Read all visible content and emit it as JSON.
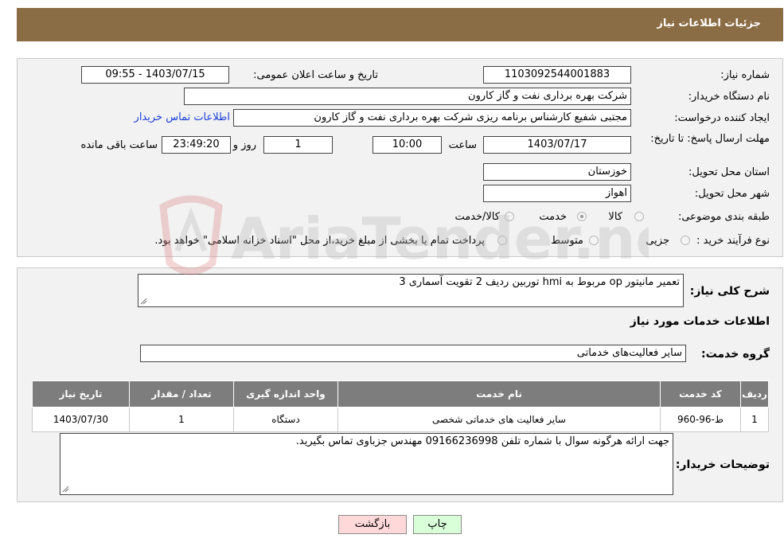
{
  "header": {
    "title": "جزئیات اطلاعات نیاز"
  },
  "form": {
    "need_number": {
      "label": "شماره نیاز:",
      "value": "1103092544001883"
    },
    "announce_datetime": {
      "label": "تاریخ و ساعت اعلان عمومی:",
      "value": "1403/07/15 - 09:55"
    },
    "buyer_org": {
      "label": "نام دستگاه خریدار:",
      "value": "شرکت بهره برداری نفت و گاز کارون"
    },
    "requester": {
      "label": "ایجاد کننده درخواست:",
      "value": "مجتبی شفیع کارشناس برنامه ریزی شرکت بهره برداری نفت و گاز کارون",
      "contact_link": "اطلاعات تماس خریدار"
    },
    "deadline": {
      "label": "مهلت ارسال پاسخ: تا تاریخ:",
      "date": "1403/07/17",
      "time_label": "ساعت",
      "time": "10:00",
      "days": "1",
      "days_label": "روز و",
      "remaining": "23:49:20",
      "remaining_label": "ساعت باقی مانده"
    },
    "province": {
      "label": "استان محل تحویل:",
      "value": "خوزستان"
    },
    "city": {
      "label": "شهر محل تحویل:",
      "value": "اهواز"
    },
    "category": {
      "label": "طبقه بندی موضوعی:",
      "options": [
        {
          "label": "کالا",
          "selected": false
        },
        {
          "label": "خدمت",
          "selected": true
        },
        {
          "label": "کالا/خدمت",
          "selected": false
        }
      ]
    },
    "purchase_type": {
      "label": "نوع فرآیند خرید :",
      "options": [
        {
          "label": "جزیی",
          "selected": false
        },
        {
          "label": "متوسط",
          "selected": false
        }
      ],
      "note": "پرداخت تمام یا بخشی از مبلغ خرید،از محل \"اسناد خزانه اسلامی\" خواهد بود."
    }
  },
  "details": {
    "summary_label": "شرح کلی نیاز:",
    "summary": "تعمیر مانیتور op مربوط به hmi توربین ردیف 2 تقویت آسماری 3",
    "services_heading": "اطلاعات خدمات مورد نیاز",
    "service_group_label": "گروه خدمت:",
    "service_group": "سایر فعالیت‌های خدماتی",
    "table": {
      "columns": [
        "ردیف",
        "کد خدمت",
        "نام خدمت",
        "واحد اندازه گیری",
        "تعداد / مقدار",
        "تاریخ نیاز"
      ],
      "rows": [
        [
          "1",
          "ط-96-960",
          "سایر فعالیت های خدماتی شخصی",
          "دستگاه",
          "1",
          "1403/07/30"
        ]
      ]
    },
    "buyer_notes_label": "توضیحات خریدار:",
    "buyer_notes": "جهت ارائه هرگونه سوال با شماره تلفن 09166236998 مهندس جزباوی تماس بگیرید."
  },
  "buttons": {
    "print": "چاپ",
    "back": "بازگشت"
  },
  "watermark": "AriaTender.neT",
  "colors": {
    "header": "#8b6d45",
    "link": "#1a3fd9",
    "back_button": "#ffd9d9",
    "print_button": "#d9ffd9",
    "table_header": "#7d7d7d"
  }
}
